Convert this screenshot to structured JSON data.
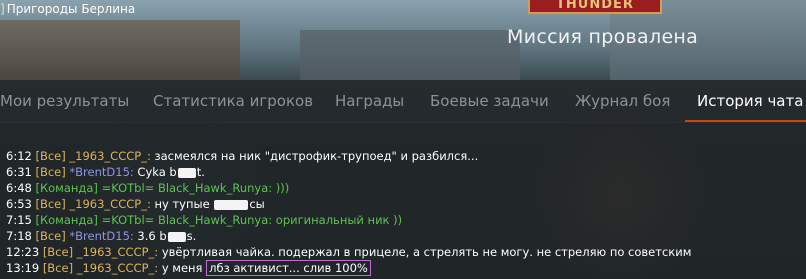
{
  "window": {
    "bracket": "]",
    "title": "Пригороды Берлина"
  },
  "logo": {
    "text": "THUNDER"
  },
  "mission": {
    "status": "Миссия провалена"
  },
  "tabs": [
    {
      "label": "Мои результаты",
      "active": false
    },
    {
      "label": "Статистика игроков",
      "active": false
    },
    {
      "label": "Награды",
      "active": false
    },
    {
      "label": "Боевые задачи",
      "active": false
    },
    {
      "label": "Журнал боя",
      "active": false
    },
    {
      "label": "История чата",
      "active": true
    }
  ],
  "chat": {
    "lines": [
      {
        "time": "6:12",
        "channel": "[Все]",
        "nick": "_1963_CCCP_:",
        "text": "засмеялся на ник \"дистрофик-трупоед\" и разбился..."
      },
      {
        "time": "6:31",
        "channel": "[Все]",
        "nick": "*BrentD15:",
        "text_before": "Cyka b",
        "text_after": "t."
      },
      {
        "time": "6:48",
        "channel": "[Команда]",
        "nick": "=KOTbl= Black_Hawk_Runya:",
        "text": ")))"
      },
      {
        "time": "6:53",
        "channel": "[Все]",
        "nick": "_1963_CCCP_:",
        "text_before": "ну тупые",
        "text_after": "сы"
      },
      {
        "time": "7:15",
        "channel": "[Команда]",
        "nick": "=KOTbl= Black_Hawk_Runya:",
        "text": "оригинальный ник ))"
      },
      {
        "time": "7:18",
        "channel": "[Все]",
        "nick": "*BrentD15:",
        "text_before": "3.6 b",
        "text_after": "s."
      },
      {
        "time": "12:23",
        "channel": "[Все]",
        "nick": "_1963_CCCP_:",
        "text": "увёртливая чайка. подержал в прицеле, а стрелять не могу. не стреляю по советским"
      },
      {
        "time": "13:19",
        "channel": "[Все]",
        "nick": "_1963_CCCP_:",
        "text_plain": "у меня",
        "text_highlight": "лбз активист... слив 100%"
      }
    ]
  },
  "colors": {
    "channel_all": "#e0b25a",
    "channel_team": "#5bc44e",
    "enemy_nick": "#8e95e6",
    "tab_active_underline": "#c3461f",
    "highlight_border": "#c06bd0"
  }
}
